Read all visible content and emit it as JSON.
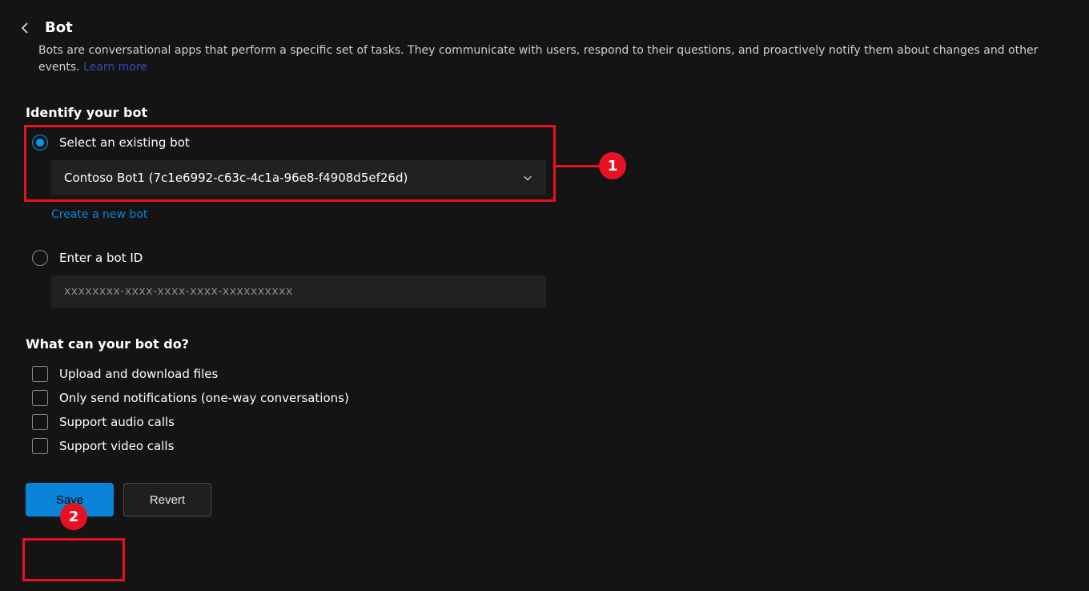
{
  "header": {
    "title": "Bot",
    "description": "Bots are conversational apps that perform a specific set of tasks. They communicate with users, respond to their questions, and proactively notify them about changes and other events.",
    "learn_more": "Learn more"
  },
  "identify": {
    "section_label": "Identify your bot",
    "select_existing": {
      "label": "Select an existing bot",
      "selected": true,
      "dropdown_value": "Contoso Bot1 (7c1e6992-c63c-4c1a-96e8-f4908d5ef26d)"
    },
    "create_new_link": "Create a new bot",
    "enter_bot_id": {
      "label": "Enter a bot ID",
      "selected": false,
      "placeholder": "xxxxxxxx-xxxx-xxxx-xxxx-xxxxxxxxxx"
    }
  },
  "capabilities": {
    "section_label": "What can your bot do?",
    "items": [
      {
        "label": "Upload and download files",
        "checked": false
      },
      {
        "label": "Only send notifications (one-way conversations)",
        "checked": false
      },
      {
        "label": "Support audio calls",
        "checked": false
      },
      {
        "label": "Support video calls",
        "checked": false
      }
    ]
  },
  "buttons": {
    "save": "Save",
    "revert": "Revert"
  },
  "annotations": {
    "badge1": "1",
    "badge2": "2"
  }
}
